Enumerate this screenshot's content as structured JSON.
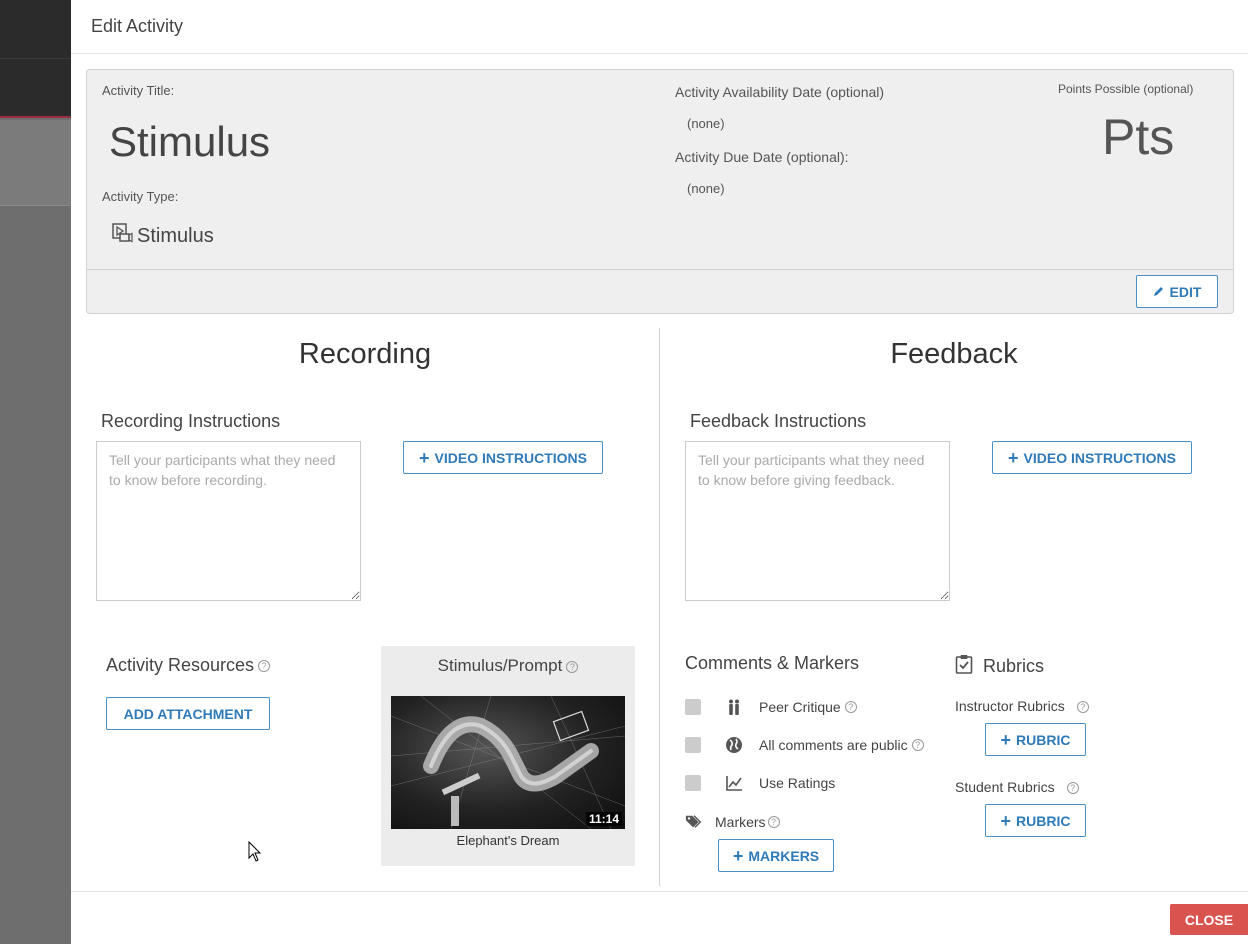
{
  "modal": {
    "title": "Edit Activity"
  },
  "info": {
    "title_label": "Activity Title:",
    "title_value": "Stimulus",
    "type_label": "Activity Type:",
    "type_value": "Stimulus",
    "type_icon": "video-stimulus-icon",
    "availability_label": "Activity Availability Date (optional)",
    "availability_value": "(none)",
    "due_label": "Activity Due Date (optional):",
    "due_value": "(none)",
    "points_label": "Points Possible (optional)",
    "points_value": "Pts",
    "edit_button": "EDIT"
  },
  "recording": {
    "heading": "Recording",
    "instructions_label": "Recording Instructions",
    "instructions_placeholder": "Tell your participants what they need to know before recording.",
    "video_button": "VIDEO INSTRUCTIONS",
    "resources_label": "Activity Resources",
    "add_attachment_button": "ADD ATTACHMENT",
    "stimulus_label": "Stimulus/Prompt",
    "stimulus_duration": "11:14",
    "stimulus_caption": "Elephant's Dream"
  },
  "feedback": {
    "heading": "Feedback",
    "instructions_label": "Feedback Instructions",
    "instructions_placeholder": "Tell your participants what they need to know before giving feedback.",
    "video_button": "VIDEO INSTRUCTIONS",
    "comments_label": "Comments & Markers",
    "options": [
      {
        "label": "Peer Critique",
        "icon": "people-icon",
        "checked": false
      },
      {
        "label": "All comments are public",
        "icon": "globe-icon",
        "checked": false
      },
      {
        "label": "Use Ratings",
        "icon": "line-chart-icon",
        "checked": false
      }
    ],
    "markers_label": "Markers",
    "markers_button": "MARKERS",
    "rubrics_label": "Rubrics",
    "instructor_rubrics_label": "Instructor Rubrics",
    "instructor_rubric_button": "RUBRIC",
    "student_rubrics_label": "Student Rubrics",
    "student_rubric_button": "RUBRIC"
  },
  "footer": {
    "close_button": "CLOSE"
  },
  "colors": {
    "primary": "#2f7ab8",
    "danger": "#d9534f",
    "panel_bg": "#efefef"
  }
}
